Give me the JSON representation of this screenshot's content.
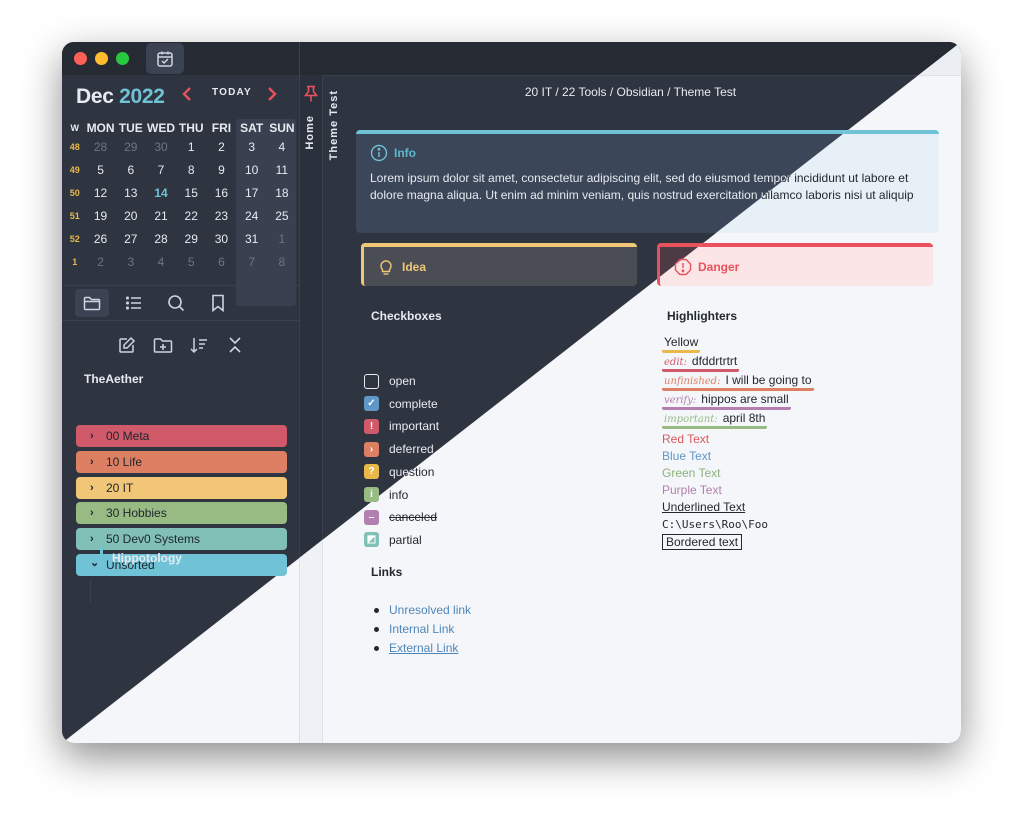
{
  "calendar": {
    "month": "Dec",
    "year": "2022",
    "today_label": "TODAY",
    "prev_icon": "‹",
    "next_icon": "›",
    "weekday_headers": [
      "W",
      "MON",
      "TUE",
      "WED",
      "THU",
      "FRI",
      "SAT",
      "SUN"
    ],
    "weeks": [
      {
        "num": "48",
        "days": [
          "28",
          "29",
          "30",
          "1",
          "2",
          "3",
          "4"
        ]
      },
      {
        "num": "49",
        "days": [
          "5",
          "6",
          "7",
          "8",
          "9",
          "10",
          "11"
        ]
      },
      {
        "num": "50",
        "days": [
          "12",
          "13",
          "14",
          "15",
          "16",
          "17",
          "18"
        ]
      },
      {
        "num": "51",
        "days": [
          "19",
          "20",
          "21",
          "22",
          "23",
          "24",
          "25"
        ]
      },
      {
        "num": "52",
        "days": [
          "26",
          "27",
          "28",
          "29",
          "30",
          "31",
          "1"
        ]
      },
      {
        "num": "1",
        "days": [
          "2",
          "3",
          "4",
          "5",
          "6",
          "7",
          "8"
        ]
      }
    ]
  },
  "explorer": {
    "vault_name": "TheAether",
    "folders": [
      {
        "label": "00 Meta",
        "color": "#d05a69",
        "expanded": false
      },
      {
        "label": "10 Life",
        "color": "#dd7f62",
        "expanded": false
      },
      {
        "label": "20 IT",
        "color": "#f1c677",
        "expanded": false
      },
      {
        "label": "30 Hobbies",
        "color": "#98bb84",
        "expanded": false
      },
      {
        "label": "50 Dev0 Systems",
        "color": "#80c0b6",
        "expanded": false
      },
      {
        "label": "Unsorted",
        "color": "#70c2d6",
        "expanded": true
      }
    ],
    "sub_item": "Hippotology"
  },
  "side_tabs": {
    "home": "Home",
    "theme_test": "Theme Test"
  },
  "breadcrumb": "20 IT  /  22 Tools  /  Obsidian  /  Theme Test",
  "callouts": {
    "info": {
      "title": "Info",
      "body": "Lorem ipsum dolor sit amet, consectetur adipiscing elit, sed do eiusmod tempor incididunt ut labore et dolore magna aliqua. Ut enim ad minim veniam, quis nostrud exercitation ullamco laboris nisi ut aliquip"
    },
    "idea": {
      "title": "Idea"
    },
    "danger": {
      "title": "Danger"
    }
  },
  "checkboxes": {
    "heading": "Checkboxes",
    "items": [
      {
        "label": "open",
        "glyph": "",
        "color": ""
      },
      {
        "label": "complete",
        "glyph": "✓",
        "color": "#5f98c6"
      },
      {
        "label": "important",
        "glyph": "!",
        "color": "#d05a69"
      },
      {
        "label": "deferred",
        "glyph": "›",
        "color": "#dd7f62"
      },
      {
        "label": "question",
        "glyph": "?",
        "color": "#e9b84a"
      },
      {
        "label": "info",
        "glyph": "i",
        "color": "#98bb84"
      },
      {
        "label": "canceled",
        "glyph": "–",
        "color": "#b27fae"
      },
      {
        "label": "partial",
        "glyph": "◩",
        "color": "#80c0b6"
      }
    ]
  },
  "highlighters": {
    "heading": "Highlighters",
    "yellow": "Yellow",
    "edit_label": "edit:",
    "edit_text": "dfddrtrtrt",
    "unfinished_label": "unfinished:",
    "unfinished_text": "I will be going to",
    "verify_label": "verify:",
    "verify_text": "hippos are small",
    "important_label": "important:",
    "important_text": "april 8th",
    "red_text": "Red Text",
    "blue_text": "Blue Text",
    "green_text": "Green Text",
    "purple_text": "Purple Text",
    "underlined_text": "Underlined Text",
    "code_text": "C:\\Users\\Roo\\Foo",
    "bordered_text": "Bordered text"
  },
  "links": {
    "heading": "Links",
    "items": [
      "Unresolved link",
      "Internal Link",
      "External Link"
    ]
  },
  "colors": {
    "dark_bg": "#2e3440",
    "dark_chrome": "#252a33",
    "light_bg": "#f4f6f9",
    "light_chrome": "#ebeef2",
    "accent_red": "#e9525c",
    "accent_blue": "#70c2d6"
  }
}
